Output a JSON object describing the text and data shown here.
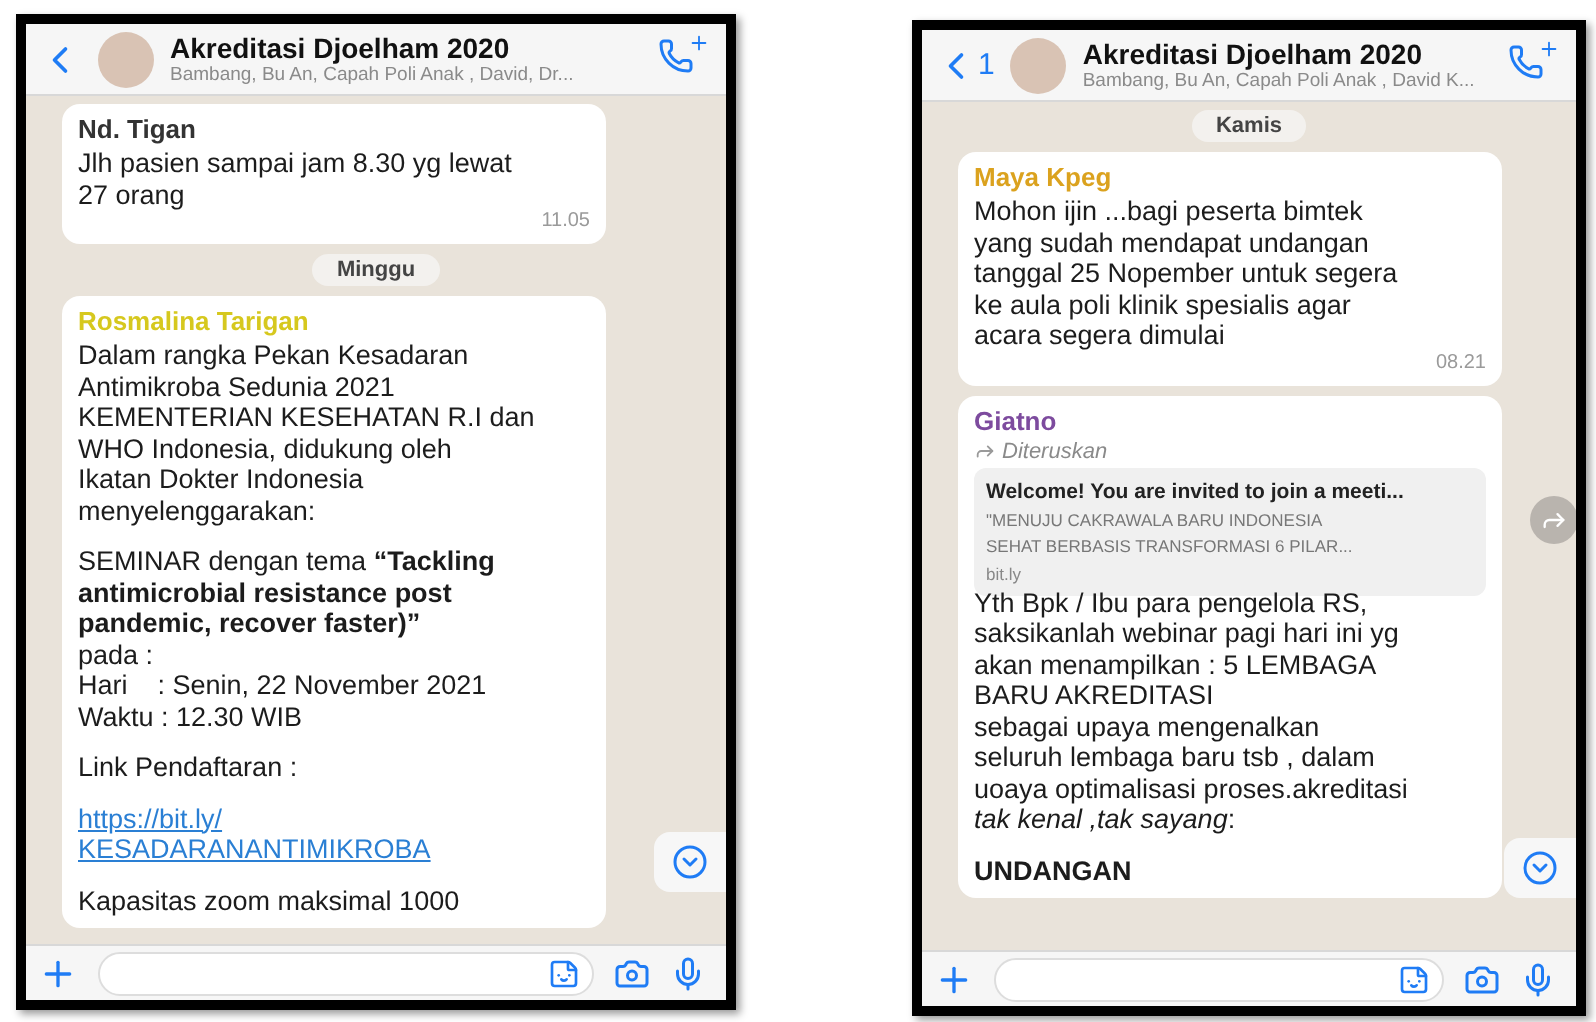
{
  "screens": [
    {
      "header": {
        "title": "Akreditasi Djoelham 2020",
        "members": "Bambang, Bu An, Capah Poli Anak , David, Dr..."
      },
      "items": [
        {
          "kind": "message",
          "sender": "Nd. Tigan",
          "color": "#333333",
          "forwarded": false,
          "blocks": [
            {
              "kind": "text",
              "text": "Jlh pasien sampai jam 8.30 yg lewat\n27 orang"
            }
          ],
          "time": "11.05"
        },
        {
          "kind": "date",
          "label": "Minggu"
        },
        {
          "kind": "message",
          "sender": "Rosmalina Tarigan",
          "color": "#d6c81e",
          "forwarded": false,
          "blocks": [
            {
              "kind": "text",
              "text": "Dalam rangka Pekan Kesadaran\nAntimikroba Sedunia 2021\nKEMENTERIAN KESEHATAN R.I dan\nWHO Indonesia, didukung oleh\nIkatan Dokter Indonesia\nmenyelenggarakan:"
            },
            {
              "kind": "text",
              "text": "SEMINAR dengan tema **“Tackling**\n**antimicrobial resistance post**\n**pandemic, recover faster)”**\npada :\nHari    : Senin, 22 November 2021\nWaktu : 12.30 WIB"
            },
            {
              "kind": "text",
              "text": "Link Pendaftaran :"
            },
            {
              "kind": "link",
              "text": "https://bit.ly/\nKESADARANANTIMIKROBA"
            },
            {
              "kind": "text",
              "text": "Kapasitas zoom maksimal 1000"
            }
          ]
        }
      ]
    },
    {
      "header": {
        "back_count": "1",
        "title": "Akreditasi Djoelham 2020",
        "members": "Bambang, Bu An, Capah Poli Anak , David K..."
      },
      "items": [
        {
          "kind": "date",
          "label": "Kamis"
        },
        {
          "kind": "message",
          "sender": "Maya Kpeg",
          "color": "#dba21e",
          "forwarded": false,
          "blocks": [
            {
              "kind": "text",
              "text": "Mohon ijin ...bagi peserta bimtek\nyang sudah mendapat undangan\ntanggal 25 Nopember untuk segera\nke aula poli klinik spesialis agar\nacara segera dimulai"
            }
          ],
          "time": "08.21"
        },
        {
          "kind": "message",
          "sender": "Giatno",
          "color": "#7d4b9e",
          "forwarded": true,
          "forward_label": "Diteruskan",
          "preview": {
            "title": "Welcome! You are invited to join a meeti...",
            "description": "\"MENUJU CAKRAWALA BARU INDONESIA\nSEHAT BERBASIS TRANSFORMASI 6 PILAR...",
            "domain": "bit.ly"
          },
          "blocks": [
            {
              "kind": "text",
              "text": "Yth Bpk / Ibu para pengelola RS,\nsaksikanlah webinar pagi hari ini yg\nakan menampilkan : 5 LEMBAGA\nBARU AKREDITASI\nsebagai upaya mengenalkan\nseluruh lembaga baru tsb , dalam\nuoaya optimalisasi proses.akreditasi\n*tak kenal ,tak sayang*:"
            },
            {
              "kind": "heading",
              "text": "UNDANGAN"
            }
          ]
        }
      ]
    }
  ]
}
